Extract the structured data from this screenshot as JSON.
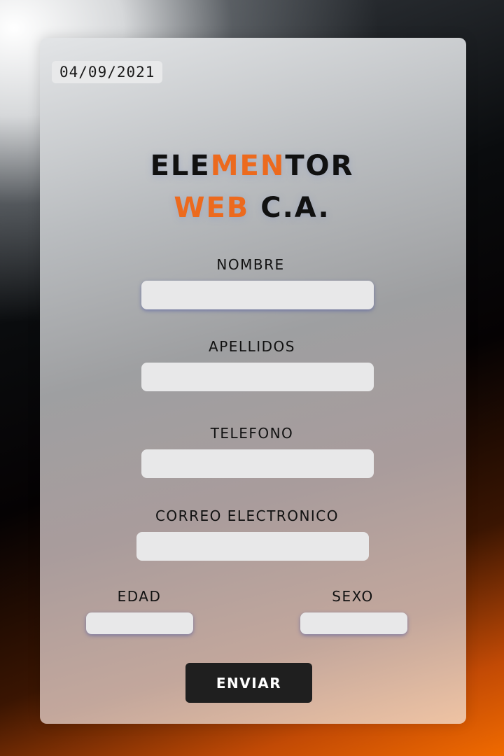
{
  "date": "04/09/2021",
  "brand": {
    "line1": [
      {
        "text": "ELE",
        "accent": false
      },
      {
        "text": "MEN",
        "accent": true
      },
      {
        "text": "TOR",
        "accent": false
      }
    ],
    "line2": [
      {
        "text": "WEB",
        "accent": true
      },
      {
        "text": " C.A.",
        "accent": false
      }
    ],
    "accent_color": "#ec6a1e"
  },
  "form": {
    "nombre_label": "NOMBRE",
    "nombre_value": "",
    "apellidos_label": "APELLIDOS",
    "apellidos_value": "",
    "telefono_label": "TELEFONO",
    "telefono_value": "",
    "correo_label": "CORREO ELECTRONICO",
    "correo_value": "",
    "edad_label": "EDAD",
    "edad_value": "",
    "sexo_label": "SEXO",
    "sexo_value": "",
    "submit_label": "ENVIAR"
  }
}
